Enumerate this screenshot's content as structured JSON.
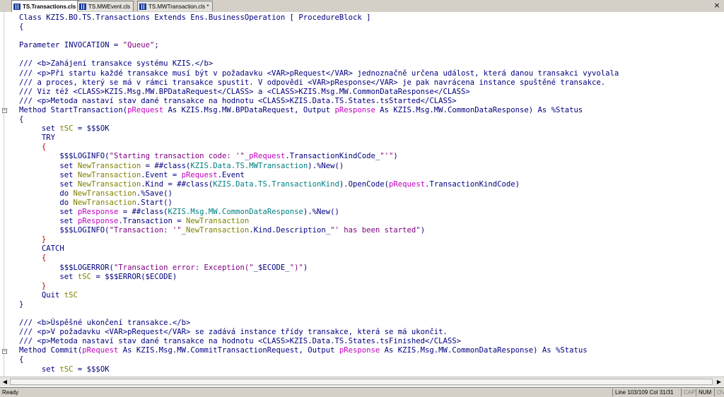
{
  "tabs": [
    {
      "label": "TS.Transactions.cls",
      "active": true
    },
    {
      "label": "TS.MWEvent.cls",
      "active": false
    },
    {
      "label": "TS.MWTransaction.cls *",
      "active": false
    }
  ],
  "close_label": "×",
  "status": {
    "text": "Ready",
    "position": "Line 103/109 Col 31/31",
    "cap": "CAP",
    "num": "NUM",
    "ovr": "OV"
  },
  "code_lines": [
    [
      {
        "t": "Class KZIS.BO.TS.Transactions Extends Ens.BusinessOperation [ ProcedureBlock ]",
        "c": "kw"
      }
    ],
    [
      {
        "t": "{",
        "c": "kw"
      }
    ],
    [
      {
        "t": "",
        "c": "kw"
      }
    ],
    [
      {
        "t": "Parameter INVOCATION = ",
        "c": "kw"
      },
      {
        "t": "\"Queue\"",
        "c": "st"
      },
      {
        "t": ";",
        "c": "kw"
      }
    ],
    [
      {
        "t": "",
        "c": "kw"
      }
    ],
    [
      {
        "t": "/// <b>Zahájení transakce systému KZIS.</b>",
        "c": "cm"
      }
    ],
    [
      {
        "t": "/// <p>Při startu každé transakce musí být v požadavku <VAR>pRequest</VAR> jednoznačně určena událost, která danou transakci vyvolala",
        "c": "cm"
      }
    ],
    [
      {
        "t": "/// a proces, který se má v rámci transakce spustit. V odpovědi <VAR>pResponse</VAR> je pak navrácena instance spuštěné transakce.",
        "c": "cm"
      }
    ],
    [
      {
        "t": "/// Viz též <CLASS>KZIS.Msg.MW.BPDataRequest</CLASS> a <CLASS>KZIS.Msg.MW.CommonDataResponse</CLASS>",
        "c": "cm"
      }
    ],
    [
      {
        "t": "/// <p>Metoda nastaví stav dané transakce na hodnotu <CLASS>KZIS.Data.TS.States.tsStarted</CLASS>",
        "c": "cm"
      }
    ],
    [
      {
        "t": "Method StartTransaction(",
        "c": "kw"
      },
      {
        "t": "pRequest",
        "c": "pr"
      },
      {
        "t": " As KZIS.Msg.MW.BPDataRequest, Output ",
        "c": "kw"
      },
      {
        "t": "pResponse",
        "c": "pr"
      },
      {
        "t": " As KZIS.Msg.MW.CommonDataResponse) As %Status",
        "c": "kw"
      }
    ],
    [
      {
        "t": "{",
        "c": "kw"
      }
    ],
    [
      {
        "t": "     set ",
        "c": "kw"
      },
      {
        "t": "tSC",
        "c": "lv"
      },
      {
        "t": " = $$$OK",
        "c": "ma"
      }
    ],
    [
      {
        "t": "     TRY",
        "c": "kw"
      }
    ],
    [
      {
        "t": "     {",
        "c": "br"
      }
    ],
    [
      {
        "t": "         $$$LOGINFO(",
        "c": "ma"
      },
      {
        "t": "\"Starting transaction code: '\"",
        "c": "st"
      },
      {
        "t": "_",
        "c": "kw"
      },
      {
        "t": "pRequest",
        "c": "pr"
      },
      {
        "t": ".TransactionKindCode_",
        "c": "mt"
      },
      {
        "t": "\"'\"",
        "c": "st"
      },
      {
        "t": ")",
        "c": "kw"
      }
    ],
    [
      {
        "t": "         set ",
        "c": "kw"
      },
      {
        "t": "NewTransaction",
        "c": "lv"
      },
      {
        "t": " = ##class(",
        "c": "kw"
      },
      {
        "t": "KZIS.Data.TS.MWTransaction",
        "c": "cl"
      },
      {
        "t": ").%New()",
        "c": "mt"
      }
    ],
    [
      {
        "t": "         set ",
        "c": "kw"
      },
      {
        "t": "NewTransaction",
        "c": "lv"
      },
      {
        "t": ".Event = ",
        "c": "mt"
      },
      {
        "t": "pRequest",
        "c": "pr"
      },
      {
        "t": ".Event",
        "c": "mt"
      }
    ],
    [
      {
        "t": "         set ",
        "c": "kw"
      },
      {
        "t": "NewTransaction",
        "c": "lv"
      },
      {
        "t": ".Kind = ##class(",
        "c": "mt"
      },
      {
        "t": "KZIS.Data.TS.TransactionKind",
        "c": "cl"
      },
      {
        "t": ").OpenCode(",
        "c": "mt"
      },
      {
        "t": "pRequest",
        "c": "pr"
      },
      {
        "t": ".TransactionKindCode)",
        "c": "mt"
      }
    ],
    [
      {
        "t": "         do ",
        "c": "kw"
      },
      {
        "t": "NewTransaction",
        "c": "lv"
      },
      {
        "t": ".%Save()",
        "c": "mt"
      }
    ],
    [
      {
        "t": "         do ",
        "c": "kw"
      },
      {
        "t": "NewTransaction",
        "c": "lv"
      },
      {
        "t": ".Start()",
        "c": "mt"
      }
    ],
    [
      {
        "t": "         set ",
        "c": "kw"
      },
      {
        "t": "pResponse",
        "c": "pr"
      },
      {
        "t": " = ##class(",
        "c": "kw"
      },
      {
        "t": "KZIS.Msg.MW.CommonDataResponse",
        "c": "cl"
      },
      {
        "t": ").%New()",
        "c": "mt"
      }
    ],
    [
      {
        "t": "         set ",
        "c": "kw"
      },
      {
        "t": "pResponse",
        "c": "pr"
      },
      {
        "t": ".Transaction = ",
        "c": "mt"
      },
      {
        "t": "NewTransaction",
        "c": "lv"
      }
    ],
    [
      {
        "t": "         $$$LOGINFO(",
        "c": "ma"
      },
      {
        "t": "\"Transaction: '\"",
        "c": "st"
      },
      {
        "t": "_",
        "c": "kw"
      },
      {
        "t": "NewTransaction",
        "c": "lv"
      },
      {
        "t": ".Kind.Description_",
        "c": "mt"
      },
      {
        "t": "\"' has been started\"",
        "c": "st"
      },
      {
        "t": ")",
        "c": "kw"
      }
    ],
    [
      {
        "t": "     }",
        "c": "br"
      }
    ],
    [
      {
        "t": "     CATCH",
        "c": "kw"
      }
    ],
    [
      {
        "t": "     {",
        "c": "br"
      }
    ],
    [
      {
        "t": "         $$$LOGERROR(",
        "c": "ma"
      },
      {
        "t": "\"Transaction error: Exception(\"",
        "c": "st"
      },
      {
        "t": "_$ECODE_",
        "c": "kw"
      },
      {
        "t": "\")\"",
        "c": "st"
      },
      {
        "t": ")",
        "c": "kw"
      }
    ],
    [
      {
        "t": "         set ",
        "c": "kw"
      },
      {
        "t": "tSC",
        "c": "lv"
      },
      {
        "t": " = $$$ERROR($ECODE)",
        "c": "ma"
      }
    ],
    [
      {
        "t": "     }",
        "c": "br"
      }
    ],
    [
      {
        "t": "     Quit ",
        "c": "kw"
      },
      {
        "t": "tSC",
        "c": "lv"
      }
    ],
    [
      {
        "t": "}",
        "c": "kw"
      }
    ],
    [
      {
        "t": "",
        "c": "kw"
      }
    ],
    [
      {
        "t": "/// <b>Úspěšné ukončení transakce.</b>",
        "c": "cm"
      }
    ],
    [
      {
        "t": "/// <p>V požadavku <VAR>pRequest</VAR> se zadává instance třídy transakce, která se má ukončit.",
        "c": "cm"
      }
    ],
    [
      {
        "t": "/// <p>Metoda nastaví stav dané transakce na hodnotu <CLASS>KZIS.Data.TS.States.tsFinished</CLASS>",
        "c": "cm"
      }
    ],
    [
      {
        "t": "Method Commit(",
        "c": "kw"
      },
      {
        "t": "pRequest",
        "c": "pr"
      },
      {
        "t": " As KZIS.Msg.MW.CommitTransactionRequest, Output ",
        "c": "kw"
      },
      {
        "t": "pResponse",
        "c": "pr"
      },
      {
        "t": " As KZIS.Msg.MW.CommonDataResponse) As %Status",
        "c": "kw"
      }
    ],
    [
      {
        "t": "{",
        "c": "kw"
      }
    ],
    [
      {
        "t": "     set ",
        "c": "kw"
      },
      {
        "t": "tSC",
        "c": "lv"
      },
      {
        "t": " = $$$OK",
        "c": "ma"
      }
    ]
  ],
  "fold_markers": [
    {
      "line": 10,
      "sign": "−"
    },
    {
      "line": 36,
      "sign": "−"
    }
  ]
}
